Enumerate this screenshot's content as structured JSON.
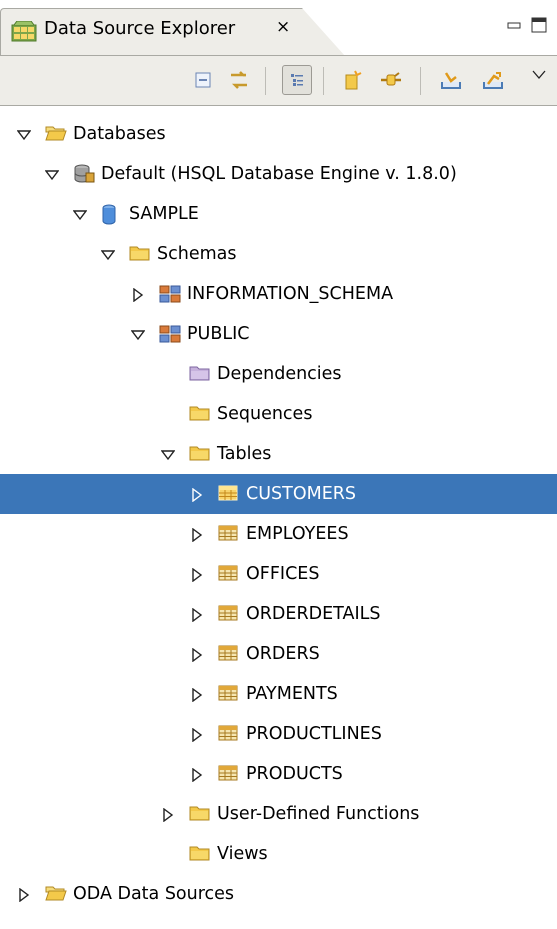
{
  "view": {
    "title": "Data Source Explorer",
    "close_glyph": "⨯"
  },
  "toolbar": {
    "buttons": [
      {
        "name": "collapse-all-icon"
      },
      {
        "name": "link-with-editor-icon"
      },
      {
        "name": "flat-layout-icon",
        "pressed": true
      },
      {
        "name": "new-connection-icon"
      },
      {
        "name": "connect-icon"
      },
      {
        "name": "import-icon"
      },
      {
        "name": "export-icon"
      },
      {
        "name": "view-menu-icon"
      }
    ]
  },
  "tree": {
    "databases": "Databases",
    "default_connection": "Default (HSQL Database Engine v. 1.8.0)",
    "sample": "SAMPLE",
    "schemas": "Schemas",
    "information_schema": "INFORMATION_SCHEMA",
    "public": "PUBLIC",
    "dependencies": "Dependencies",
    "sequences": "Sequences",
    "tables": "Tables",
    "table_items": [
      "CUSTOMERS",
      "EMPLOYEES",
      "OFFICES",
      "ORDERDETAILS",
      "ORDERS",
      "PAYMENTS",
      "PRODUCTLINES",
      "PRODUCTS"
    ],
    "udf": "User-Defined Functions",
    "views": "Views",
    "oda": "ODA Data Sources"
  },
  "colors": {
    "selection": "#3b76b8",
    "folder": "#f3c94a",
    "chrome": "#eeede8"
  }
}
